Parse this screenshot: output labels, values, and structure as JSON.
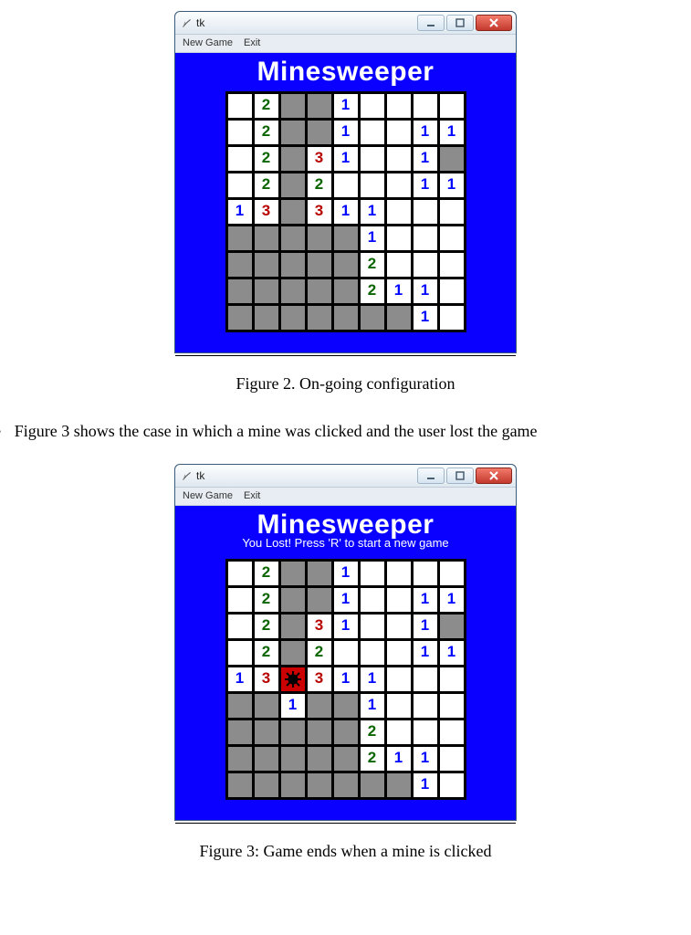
{
  "captions": {
    "fig2": "Figure 2. On-going configuration",
    "bullet_text": "Figure 3 shows the case in which a mine was clicked and the user lost the game",
    "fig3": "Figure 3: Game ends when a mine is clicked"
  },
  "window": {
    "title": "tk",
    "menu": {
      "new_game": "New Game",
      "exit": "Exit"
    },
    "game_title": "Minesweeper",
    "lost_status": "You Lost! Press 'R' to start a new game"
  },
  "board_common": {
    "rows": 9,
    "cols": 9,
    "comment": "cells: '' = revealed blank, '.' = unrevealed, numbers as string, '*' = mine",
    "grid": [
      [
        "",
        "2",
        ".",
        ".",
        "1",
        "",
        "",
        "",
        ""
      ],
      [
        "",
        "2",
        ".",
        ".",
        "1",
        "",
        "",
        "1",
        "1"
      ],
      [
        "",
        "2",
        ".",
        "3",
        "1",
        "",
        "",
        "1",
        "."
      ],
      [
        "",
        "2",
        ".",
        "2",
        "",
        "",
        "",
        "1",
        "1"
      ],
      [
        "1",
        "3",
        ".",
        "3",
        "1",
        "1",
        "",
        "",
        ""
      ],
      [
        ".",
        ".",
        ".",
        ".",
        ".",
        "1",
        "",
        "",
        ""
      ],
      [
        ".",
        ".",
        ".",
        ".",
        ".",
        "2",
        "",
        "",
        ""
      ],
      [
        ".",
        ".",
        ".",
        ".",
        ".",
        "2",
        "1",
        "1",
        ""
      ],
      [
        ".",
        ".",
        ".",
        ".",
        ".",
        ".",
        ".",
        "1",
        ""
      ]
    ]
  },
  "board_fig3_overrides": {
    "mine": [
      4,
      2
    ],
    "extra_reveals": [
      [
        5,
        2,
        "1"
      ]
    ]
  }
}
